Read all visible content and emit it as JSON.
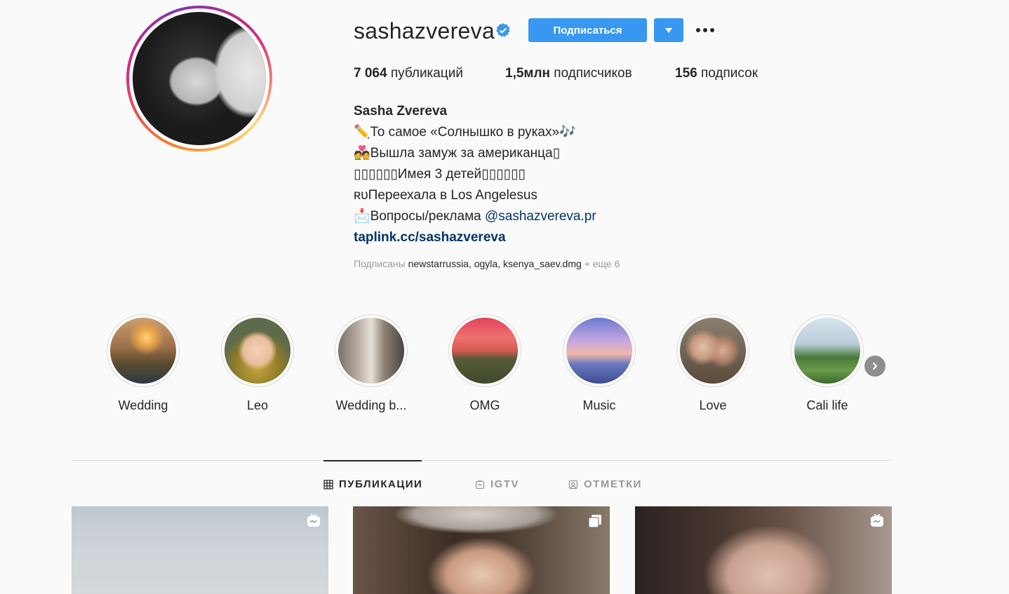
{
  "profile": {
    "username": "sashazvereva",
    "follow_label": "Подписаться",
    "stats": {
      "posts_count": "7 064",
      "posts_label": "публикаций",
      "followers_count": "1,5млн",
      "followers_label": "подписчиков",
      "following_count": "156",
      "following_label": "подписок"
    },
    "bio": {
      "full_name": "Sasha Zvereva",
      "line1": "✏️То самое «Солнышко в руках»🎶",
      "line2": "💑Вышла замуж за американца▯",
      "line3": "▯▯▯▯▯▯Имея 3 детей▯▯▯▯▯▯",
      "line4": "ʀᴜПереехала в Los Angelesus",
      "line5_prefix": "📩Вопросы/реклама ",
      "line5_mention": "@sashazvereva.pr",
      "link": "taplink.cc/sashazvereva"
    },
    "followed_by": {
      "prefix": "Подписаны",
      "accounts": "newstarrussia, ogyla, ksenya_saev.dmg",
      "more": "+ еще 6"
    }
  },
  "highlights": [
    {
      "label": "Wedding"
    },
    {
      "label": "Leo"
    },
    {
      "label": "Wedding b..."
    },
    {
      "label": "OMG"
    },
    {
      "label": "Music"
    },
    {
      "label": "Love"
    },
    {
      "label": "Cali life"
    }
  ],
  "tabs": [
    {
      "label": "ПУБЛИКАЦИИ",
      "icon": "grid-icon"
    },
    {
      "label": "IGTV",
      "icon": "igtv-icon"
    },
    {
      "label": "ОТМЕТКИ",
      "icon": "tagged-icon"
    }
  ],
  "colors": {
    "accent": "#3897f0",
    "link": "#003569",
    "background": "#fafafa"
  }
}
